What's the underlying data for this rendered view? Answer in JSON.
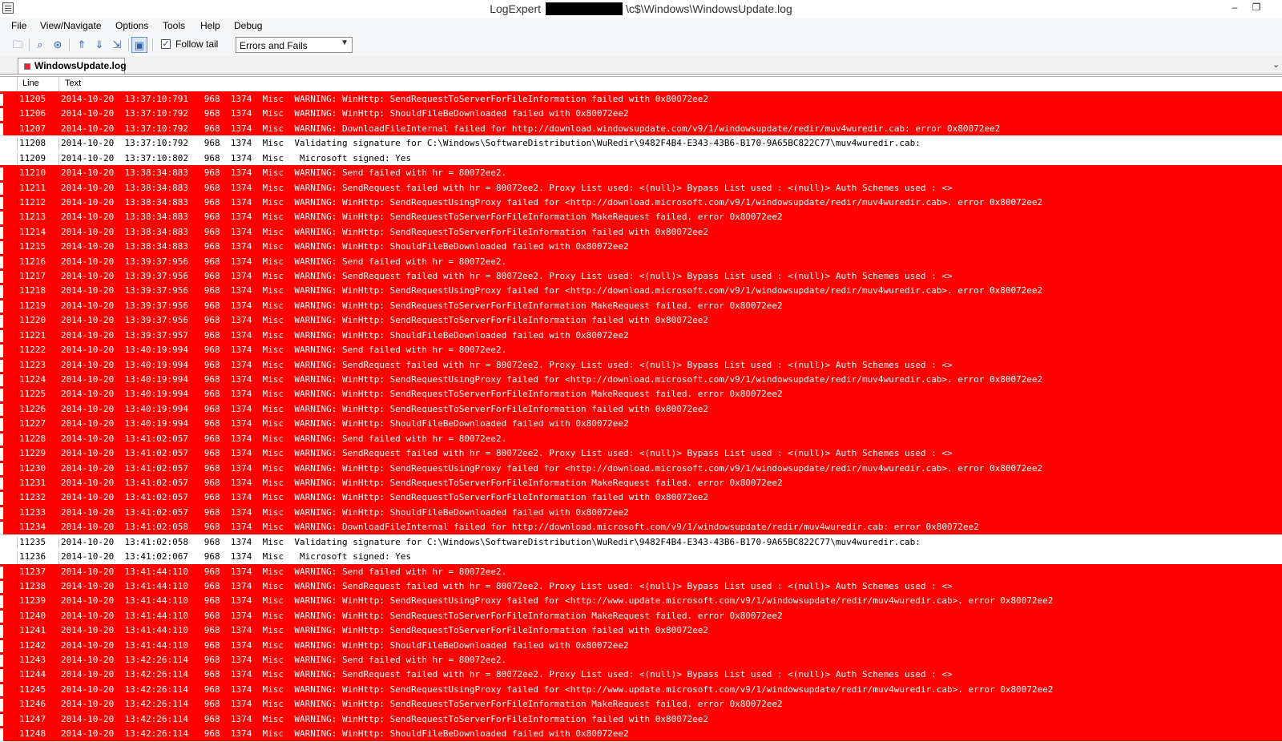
{
  "window": {
    "app_name": "LogExpert",
    "path_suffix": "\\c$\\Windows\\WindowsUpdate.log",
    "minimize_glyph": "–",
    "restore_glyph": "❐"
  },
  "menu": {
    "items": [
      "File",
      "View/Navigate",
      "Options",
      "Tools",
      "Help",
      "Debug"
    ]
  },
  "toolbar": {
    "buttons": [
      {
        "name": "open-file-icon",
        "glyph": "🗀"
      },
      {
        "name": "search-icon",
        "glyph": "⌕"
      },
      {
        "name": "filter-icon",
        "glyph": "⊛"
      },
      {
        "name": "prev-bookmark-icon",
        "glyph": "⇑"
      },
      {
        "name": "next-bookmark-icon",
        "glyph": "⇓"
      },
      {
        "name": "goto-bookmark-icon",
        "glyph": "⇲"
      },
      {
        "name": "highlight-icon",
        "glyph": "▣"
      }
    ],
    "follow_tail_checked": true,
    "follow_tail_label": "Follow tail",
    "filter_selected": "Errors and Fails"
  },
  "tabs": [
    {
      "label": "WindowsUpdate.log",
      "active": true
    }
  ],
  "grid": {
    "columns": [
      "Line",
      "Text"
    ],
    "rows": [
      {
        "line": "11205",
        "text": "2014-10-20  13:37:10:791   968  1374  Misc  WARNING: WinHttp: SendRequestToServerForFileInformation failed with 0x80072ee2",
        "error": true
      },
      {
        "line": "11206",
        "text": "2014-10-20  13:37:10:792   968  1374  Misc  WARNING: WinHttp: ShouldFileBeDownloaded failed with 0x80072ee2",
        "error": true
      },
      {
        "line": "11207",
        "text": "2014-10-20  13:37:10:792   968  1374  Misc  WARNING: DownloadFileInternal failed for http://download.windowsupdate.com/v9/1/windowsupdate/redir/muv4wuredir.cab: error 0x80072ee2",
        "error": true
      },
      {
        "line": "11208",
        "text": "2014-10-20  13:37:10:792   968  1374  Misc  Validating signature for C:\\Windows\\SoftwareDistribution\\WuRedir\\9482F4B4-E343-43B6-B170-9A65BC822C77\\muv4wuredir.cab:",
        "error": false
      },
      {
        "line": "11209",
        "text": "2014-10-20  13:37:10:802   968  1374  Misc   Microsoft signed: Yes",
        "error": false
      },
      {
        "line": "11210",
        "text": "2014-10-20  13:38:34:883   968  1374  Misc  WARNING: Send failed with hr = 80072ee2.",
        "error": true
      },
      {
        "line": "11211",
        "text": "2014-10-20  13:38:34:883   968  1374  Misc  WARNING: SendRequest failed with hr = 80072ee2. Proxy List used: <(null)> Bypass List used : <(null)> Auth Schemes used : <>",
        "error": true
      },
      {
        "line": "11212",
        "text": "2014-10-20  13:38:34:883   968  1374  Misc  WARNING: WinHttp: SendRequestUsingProxy failed for <http://download.microsoft.com/v9/1/windowsupdate/redir/muv4wuredir.cab>. error 0x80072ee2",
        "error": true
      },
      {
        "line": "11213",
        "text": "2014-10-20  13:38:34:883   968  1374  Misc  WARNING: WinHttp: SendRequestToServerForFileInformation MakeRequest failed. error 0x80072ee2",
        "error": true
      },
      {
        "line": "11214",
        "text": "2014-10-20  13:38:34:883   968  1374  Misc  WARNING: WinHttp: SendRequestToServerForFileInformation failed with 0x80072ee2",
        "error": true
      },
      {
        "line": "11215",
        "text": "2014-10-20  13:38:34:883   968  1374  Misc  WARNING: WinHttp: ShouldFileBeDownloaded failed with 0x80072ee2",
        "error": true
      },
      {
        "line": "11216",
        "text": "2014-10-20  13:39:37:956   968  1374  Misc  WARNING: Send failed with hr = 80072ee2.",
        "error": true
      },
      {
        "line": "11217",
        "text": "2014-10-20  13:39:37:956   968  1374  Misc  WARNING: SendRequest failed with hr = 80072ee2. Proxy List used: <(null)> Bypass List used : <(null)> Auth Schemes used : <>",
        "error": true
      },
      {
        "line": "11218",
        "text": "2014-10-20  13:39:37:956   968  1374  Misc  WARNING: WinHttp: SendRequestUsingProxy failed for <http://download.microsoft.com/v9/1/windowsupdate/redir/muv4wuredir.cab>. error 0x80072ee2",
        "error": true
      },
      {
        "line": "11219",
        "text": "2014-10-20  13:39:37:956   968  1374  Misc  WARNING: WinHttp: SendRequestToServerForFileInformation MakeRequest failed. error 0x80072ee2",
        "error": true
      },
      {
        "line": "11220",
        "text": "2014-10-20  13:39:37:956   968  1374  Misc  WARNING: WinHttp: SendRequestToServerForFileInformation failed with 0x80072ee2",
        "error": true
      },
      {
        "line": "11221",
        "text": "2014-10-20  13:39:37:957   968  1374  Misc  WARNING: WinHttp: ShouldFileBeDownloaded failed with 0x80072ee2",
        "error": true
      },
      {
        "line": "11222",
        "text": "2014-10-20  13:40:19:994   968  1374  Misc  WARNING: Send failed with hr = 80072ee2.",
        "error": true
      },
      {
        "line": "11223",
        "text": "2014-10-20  13:40:19:994   968  1374  Misc  WARNING: SendRequest failed with hr = 80072ee2. Proxy List used: <(null)> Bypass List used : <(null)> Auth Schemes used : <>",
        "error": true
      },
      {
        "line": "11224",
        "text": "2014-10-20  13:40:19:994   968  1374  Misc  WARNING: WinHttp: SendRequestUsingProxy failed for <http://download.microsoft.com/v9/1/windowsupdate/redir/muv4wuredir.cab>. error 0x80072ee2",
        "error": true
      },
      {
        "line": "11225",
        "text": "2014-10-20  13:40:19:994   968  1374  Misc  WARNING: WinHttp: SendRequestToServerForFileInformation MakeRequest failed. error 0x80072ee2",
        "error": true
      },
      {
        "line": "11226",
        "text": "2014-10-20  13:40:19:994   968  1374  Misc  WARNING: WinHttp: SendRequestToServerForFileInformation failed with 0x80072ee2",
        "error": true
      },
      {
        "line": "11227",
        "text": "2014-10-20  13:40:19:994   968  1374  Misc  WARNING: WinHttp: ShouldFileBeDownloaded failed with 0x80072ee2",
        "error": true
      },
      {
        "line": "11228",
        "text": "2014-10-20  13:41:02:057   968  1374  Misc  WARNING: Send failed with hr = 80072ee2.",
        "error": true
      },
      {
        "line": "11229",
        "text": "2014-10-20  13:41:02:057   968  1374  Misc  WARNING: SendRequest failed with hr = 80072ee2. Proxy List used: <(null)> Bypass List used : <(null)> Auth Schemes used : <>",
        "error": true
      },
      {
        "line": "11230",
        "text": "2014-10-20  13:41:02:057   968  1374  Misc  WARNING: WinHttp: SendRequestUsingProxy failed for <http://download.microsoft.com/v9/1/windowsupdate/redir/muv4wuredir.cab>. error 0x80072ee2",
        "error": true
      },
      {
        "line": "11231",
        "text": "2014-10-20  13:41:02:057   968  1374  Misc  WARNING: WinHttp: SendRequestToServerForFileInformation MakeRequest failed. error 0x80072ee2",
        "error": true
      },
      {
        "line": "11232",
        "text": "2014-10-20  13:41:02:057   968  1374  Misc  WARNING: WinHttp: SendRequestToServerForFileInformation failed with 0x80072ee2",
        "error": true
      },
      {
        "line": "11233",
        "text": "2014-10-20  13:41:02:057   968  1374  Misc  WARNING: WinHttp: ShouldFileBeDownloaded failed with 0x80072ee2",
        "error": true
      },
      {
        "line": "11234",
        "text": "2014-10-20  13:41:02:058   968  1374  Misc  WARNING: DownloadFileInternal failed for http://download.microsoft.com/v9/1/windowsupdate/redir/muv4wuredir.cab: error 0x80072ee2",
        "error": true
      },
      {
        "line": "11235",
        "text": "2014-10-20  13:41:02:058   968  1374  Misc  Validating signature for C:\\Windows\\SoftwareDistribution\\WuRedir\\9482F4B4-E343-43B6-B170-9A65BC822C77\\muv4wuredir.cab:",
        "error": false
      },
      {
        "line": "11236",
        "text": "2014-10-20  13:41:02:067   968  1374  Misc   Microsoft signed: Yes",
        "error": false
      },
      {
        "line": "11237",
        "text": "2014-10-20  13:41:44:110   968  1374  Misc  WARNING: Send failed with hr = 80072ee2.",
        "error": true
      },
      {
        "line": "11238",
        "text": "2014-10-20  13:41:44:110   968  1374  Misc  WARNING: SendRequest failed with hr = 80072ee2. Proxy List used: <(null)> Bypass List used : <(null)> Auth Schemes used : <>",
        "error": true
      },
      {
        "line": "11239",
        "text": "2014-10-20  13:41:44:110   968  1374  Misc  WARNING: WinHttp: SendRequestUsingProxy failed for <http://www.update.microsoft.com/v9/1/windowsupdate/redir/muv4wuredir.cab>. error 0x80072ee2",
        "error": true
      },
      {
        "line": "11240",
        "text": "2014-10-20  13:41:44:110   968  1374  Misc  WARNING: WinHttp: SendRequestToServerForFileInformation MakeRequest failed. error 0x80072ee2",
        "error": true
      },
      {
        "line": "11241",
        "text": "2014-10-20  13:41:44:110   968  1374  Misc  WARNING: WinHttp: SendRequestToServerForFileInformation failed with 0x80072ee2",
        "error": true
      },
      {
        "line": "11242",
        "text": "2014-10-20  13:41:44:110   968  1374  Misc  WARNING: WinHttp: ShouldFileBeDownloaded failed with 0x80072ee2",
        "error": true
      },
      {
        "line": "11243",
        "text": "2014-10-20  13:42:26:114   968  1374  Misc  WARNING: Send failed with hr = 80072ee2.",
        "error": true
      },
      {
        "line": "11244",
        "text": "2014-10-20  13:42:26:114   968  1374  Misc  WARNING: SendRequest failed with hr = 80072ee2. Proxy List used: <(null)> Bypass List used : <(null)> Auth Schemes used : <>",
        "error": true
      },
      {
        "line": "11245",
        "text": "2014-10-20  13:42:26:114   968  1374  Misc  WARNING: WinHttp: SendRequestUsingProxy failed for <http://www.update.microsoft.com/v9/1/windowsupdate/redir/muv4wuredir.cab>. error 0x80072ee2",
        "error": true
      },
      {
        "line": "11246",
        "text": "2014-10-20  13:42:26:114   968  1374  Misc  WARNING: WinHttp: SendRequestToServerForFileInformation MakeRequest failed. error 0x80072ee2",
        "error": true
      },
      {
        "line": "11247",
        "text": "2014-10-20  13:42:26:114   968  1374  Misc  WARNING: WinHttp: SendRequestToServerForFileInformation failed with 0x80072ee2",
        "error": true
      },
      {
        "line": "11248",
        "text": "2014-10-20  13:42:26:114   968  1374  Misc  WARNING: WinHttp: ShouldFileBeDownloaded failed with 0x80072ee2",
        "error": true
      }
    ]
  },
  "colors": {
    "error_row_bg": "#ff0000",
    "error_row_fg": "#ffffff",
    "normal_row_bg": "#ffffff",
    "normal_row_fg": "#000000"
  }
}
